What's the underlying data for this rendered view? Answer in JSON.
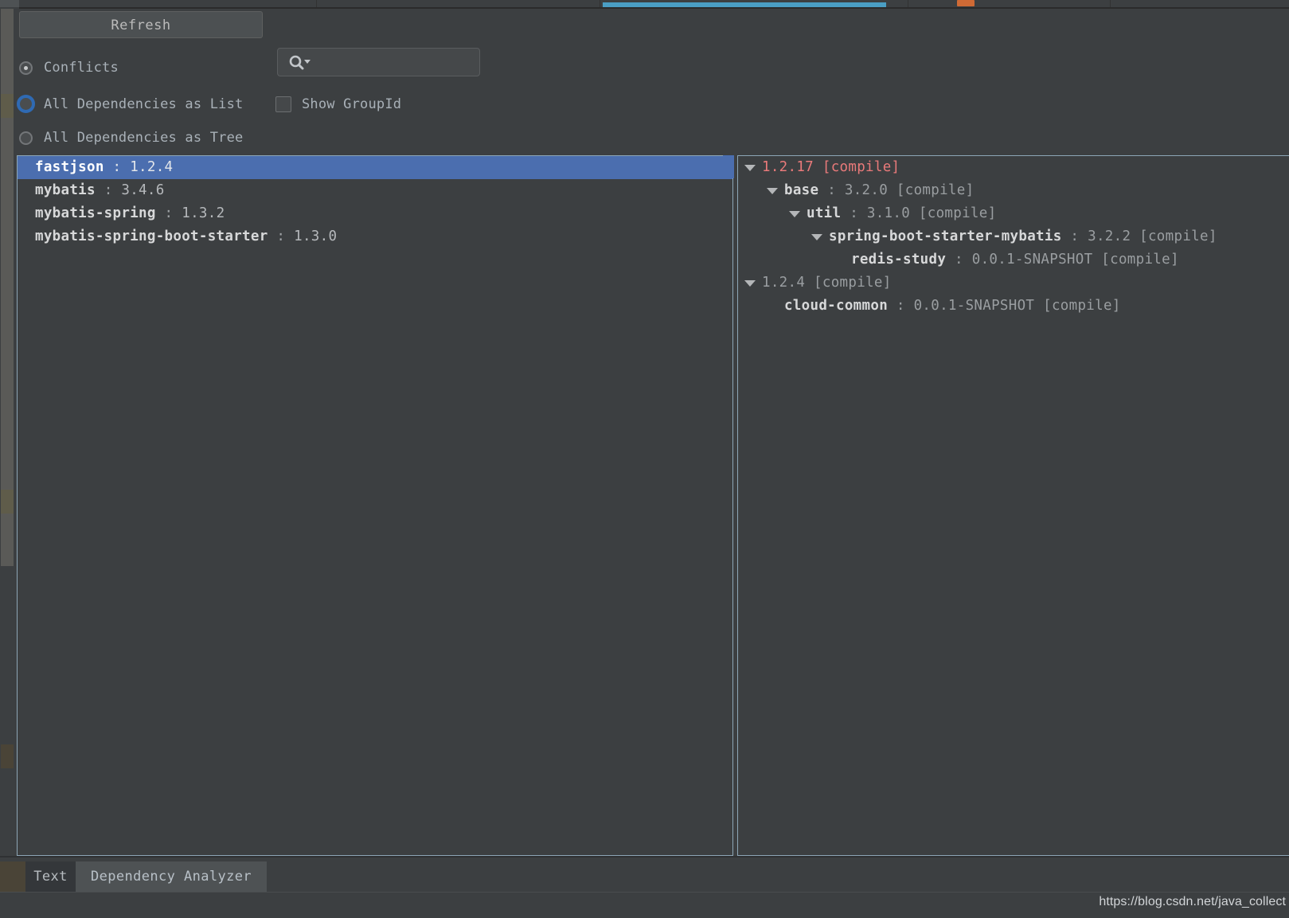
{
  "toolbar": {
    "refresh_label": "Refresh",
    "search_placeholder": "",
    "search_value": "",
    "search_icon": "search-icon"
  },
  "options": {
    "conflicts": {
      "label": "Conflicts",
      "selected": true
    },
    "all_as_list": {
      "label": "All Dependencies as List",
      "selected": false
    },
    "all_as_tree": {
      "label": "All Dependencies as Tree",
      "selected": false
    },
    "show_groupid": {
      "label": "Show GroupId",
      "checked": false
    }
  },
  "conflict_list": {
    "items": [
      {
        "artifact": "fastjson",
        "separator": ":",
        "version": "1.2.4",
        "selected": true
      },
      {
        "artifact": "mybatis",
        "separator": ":",
        "version": "3.4.6",
        "selected": false
      },
      {
        "artifact": "mybatis-spring",
        "separator": ":",
        "version": "1.3.2",
        "selected": false
      },
      {
        "artifact": "mybatis-spring-boot-starter",
        "separator": ":",
        "version": "1.3.0",
        "selected": false
      }
    ]
  },
  "dependency_tree": {
    "rows": [
      {
        "indent": 0,
        "twisty": true,
        "name": "",
        "separator": "",
        "version": "1.2.17",
        "scope": "[compile]",
        "conflict": true
      },
      {
        "indent": 1,
        "twisty": true,
        "name": "base",
        "separator": ":",
        "version": "3.2.0",
        "scope": "[compile]",
        "conflict": false
      },
      {
        "indent": 2,
        "twisty": true,
        "name": "util",
        "separator": ":",
        "version": "3.1.0",
        "scope": "[compile]",
        "conflict": false
      },
      {
        "indent": 3,
        "twisty": true,
        "name": "spring-boot-starter-mybatis",
        "separator": ":",
        "version": "3.2.2",
        "scope": "[compile]",
        "conflict": false
      },
      {
        "indent": 4,
        "twisty": false,
        "name": "redis-study",
        "separator": ":",
        "version": "0.0.1-SNAPSHOT",
        "scope": "[compile]",
        "conflict": false
      },
      {
        "indent": 0,
        "twisty": true,
        "name": "",
        "separator": "",
        "version": "1.2.4",
        "scope": "[compile]",
        "conflict": false
      },
      {
        "indent": 1,
        "twisty": false,
        "name": "cloud-common",
        "separator": ":",
        "version": "0.0.1-SNAPSHOT",
        "scope": "[compile]",
        "conflict": false
      }
    ]
  },
  "bottom_tabs": {
    "tabs": [
      {
        "label": "Text",
        "active": false
      },
      {
        "label": "Dependency Analyzer",
        "active": true
      }
    ]
  },
  "watermark": "https://blog.csdn.net/java_collect",
  "colors": {
    "background": "#3c3f41",
    "selection": "#4b6eaf",
    "conflict_red": "#e97a7a",
    "accent_cyan": "#4a9ec4",
    "panel_border": "#8da6b6",
    "text_primary": "#d7d8d9",
    "text_secondary": "#9a9ea1"
  }
}
